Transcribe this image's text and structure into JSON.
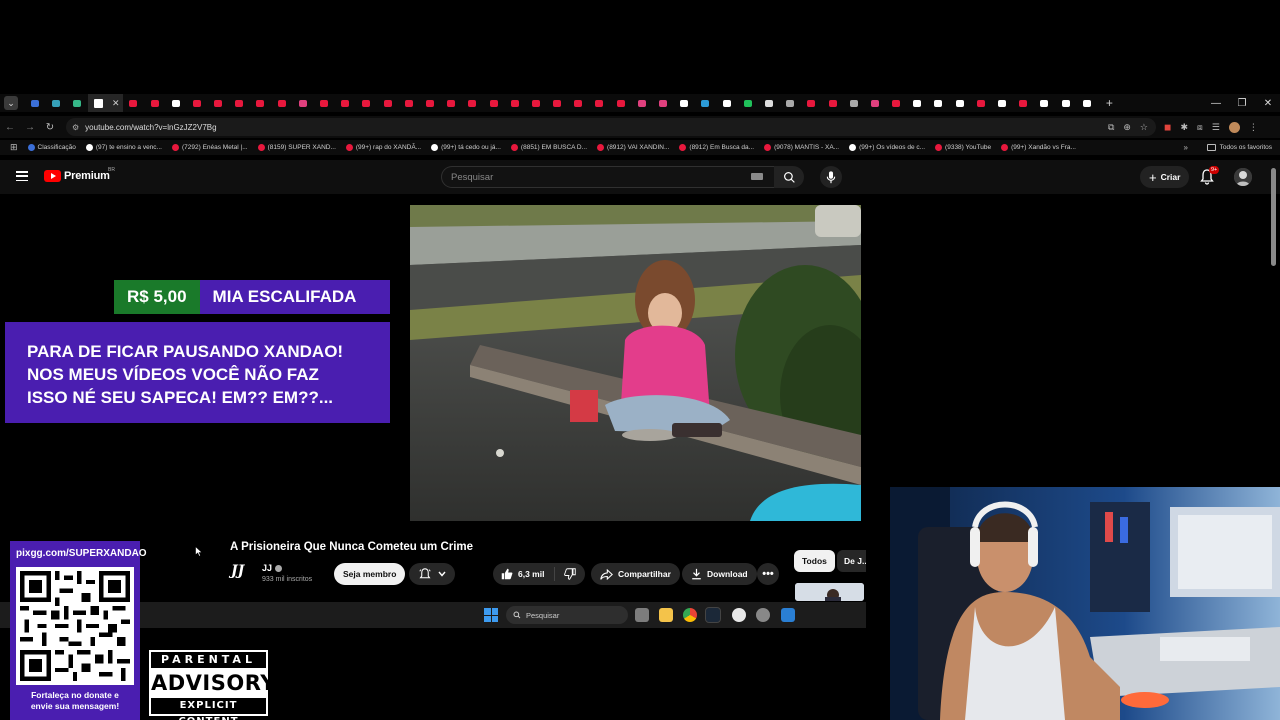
{
  "browser": {
    "url": "youtube.com/watch?v=lnGzJZ2V7Bg",
    "tab_favicon_colors": [
      "#3b6fd8",
      "#35a0b8",
      "#36b888",
      "#ffffff",
      "#e8183d",
      "#e8183d",
      "#ffffff",
      "#e8183d",
      "#e8183d",
      "#e8183d",
      "#e8183d",
      "#e8183d",
      "#e0407e",
      "#e8183d",
      "#e8183d",
      "#e8183d",
      "#e8183d",
      "#e8183d",
      "#e8183d",
      "#e8183d",
      "#e8183d",
      "#e8183d",
      "#e8183d",
      "#e8183d",
      "#e8183d",
      "#e8183d",
      "#e8183d",
      "#e8183d",
      "#e0407e",
      "#e0407e",
      "#ffffff",
      "#2c9bd8",
      "#ffffff",
      "#20c15a",
      "#dddddd",
      "#aaaaaa",
      "#e8183d",
      "#e8183d",
      "#aaaaaa",
      "#e0407e",
      "#e8183d",
      "#ffffff",
      "#ffffff",
      "#ffffff",
      "#e8183d",
      "#ffffff",
      "#e8183d",
      "#ffffff",
      "#ffffff",
      "#ffffff"
    ],
    "bookmarks": [
      {
        "label": "Classificação",
        "color": "#3b6fd8"
      },
      {
        "label": "(97) te ensino a venc...",
        "color": "#ffffff"
      },
      {
        "label": "(7292) Enéas Metal |...",
        "color": "#e8183d"
      },
      {
        "label": "(8159) SUPER XAND...",
        "color": "#e8183d"
      },
      {
        "label": "(99+) rap do XANDÃ...",
        "color": "#e8183d"
      },
      {
        "label": "(99+) tá cedo ou já...",
        "color": "#ffffff"
      },
      {
        "label": "(8851) EM BUSCA D...",
        "color": "#e8183d"
      },
      {
        "label": "(8912) VAI XANDIN...",
        "color": "#e8183d"
      },
      {
        "label": "(8912) Em Busca da...",
        "color": "#e8183d"
      },
      {
        "label": "(9078) MANTIS - XA...",
        "color": "#e8183d"
      },
      {
        "label": "(99+) Os vídeos de c...",
        "color": "#ffffff"
      },
      {
        "label": "(9338) YouTube",
        "color": "#e8183d"
      },
      {
        "label": "(99+) Xandão vs Fra...",
        "color": "#e8183d"
      }
    ],
    "bookmarks_folder": "Todos os favoritos",
    "more_chevron": "»"
  },
  "youtube": {
    "brand": "Premium",
    "country": "BR",
    "search_placeholder": "Pesquisar",
    "create_label": "Criar",
    "notification_count": "9+"
  },
  "donation": {
    "amount": "R$ 5,00",
    "donor": "MIA ESCALIFADA",
    "message_lines": [
      "PARA DE FICAR PAUSANDO XANDAO!",
      "NOS MEUS VÍDEOS VOCÊ NÃO FAZ",
      "ISSO NÉ SEU SAPECA! EM?? EM??..."
    ]
  },
  "video": {
    "title": "A Prisioneira Que Nunca Cometeu um Crime",
    "channel_logo_text": "JJ",
    "channel_name": "JJ",
    "subscribers": "933 mil inscritos",
    "member_label": "Seja membro",
    "likes": "6,3 mil",
    "share_label": "Compartilhar",
    "download_label": "Download",
    "more_label": "•••"
  },
  "chips": {
    "all": "Todos",
    "second": "De J..."
  },
  "taskbar": {
    "search_placeholder": "Pesquisar"
  },
  "overlay": {
    "qr_url": "pixgg.com/SUPERXANDAO",
    "qr_caption_lines": [
      "Fortaleça no donate e",
      "envie sua mensagem!"
    ],
    "parental_top": "PARENTAL",
    "parental_mid": "ADVISORY",
    "parental_bottom": "EXPLICIT CONTENT"
  }
}
